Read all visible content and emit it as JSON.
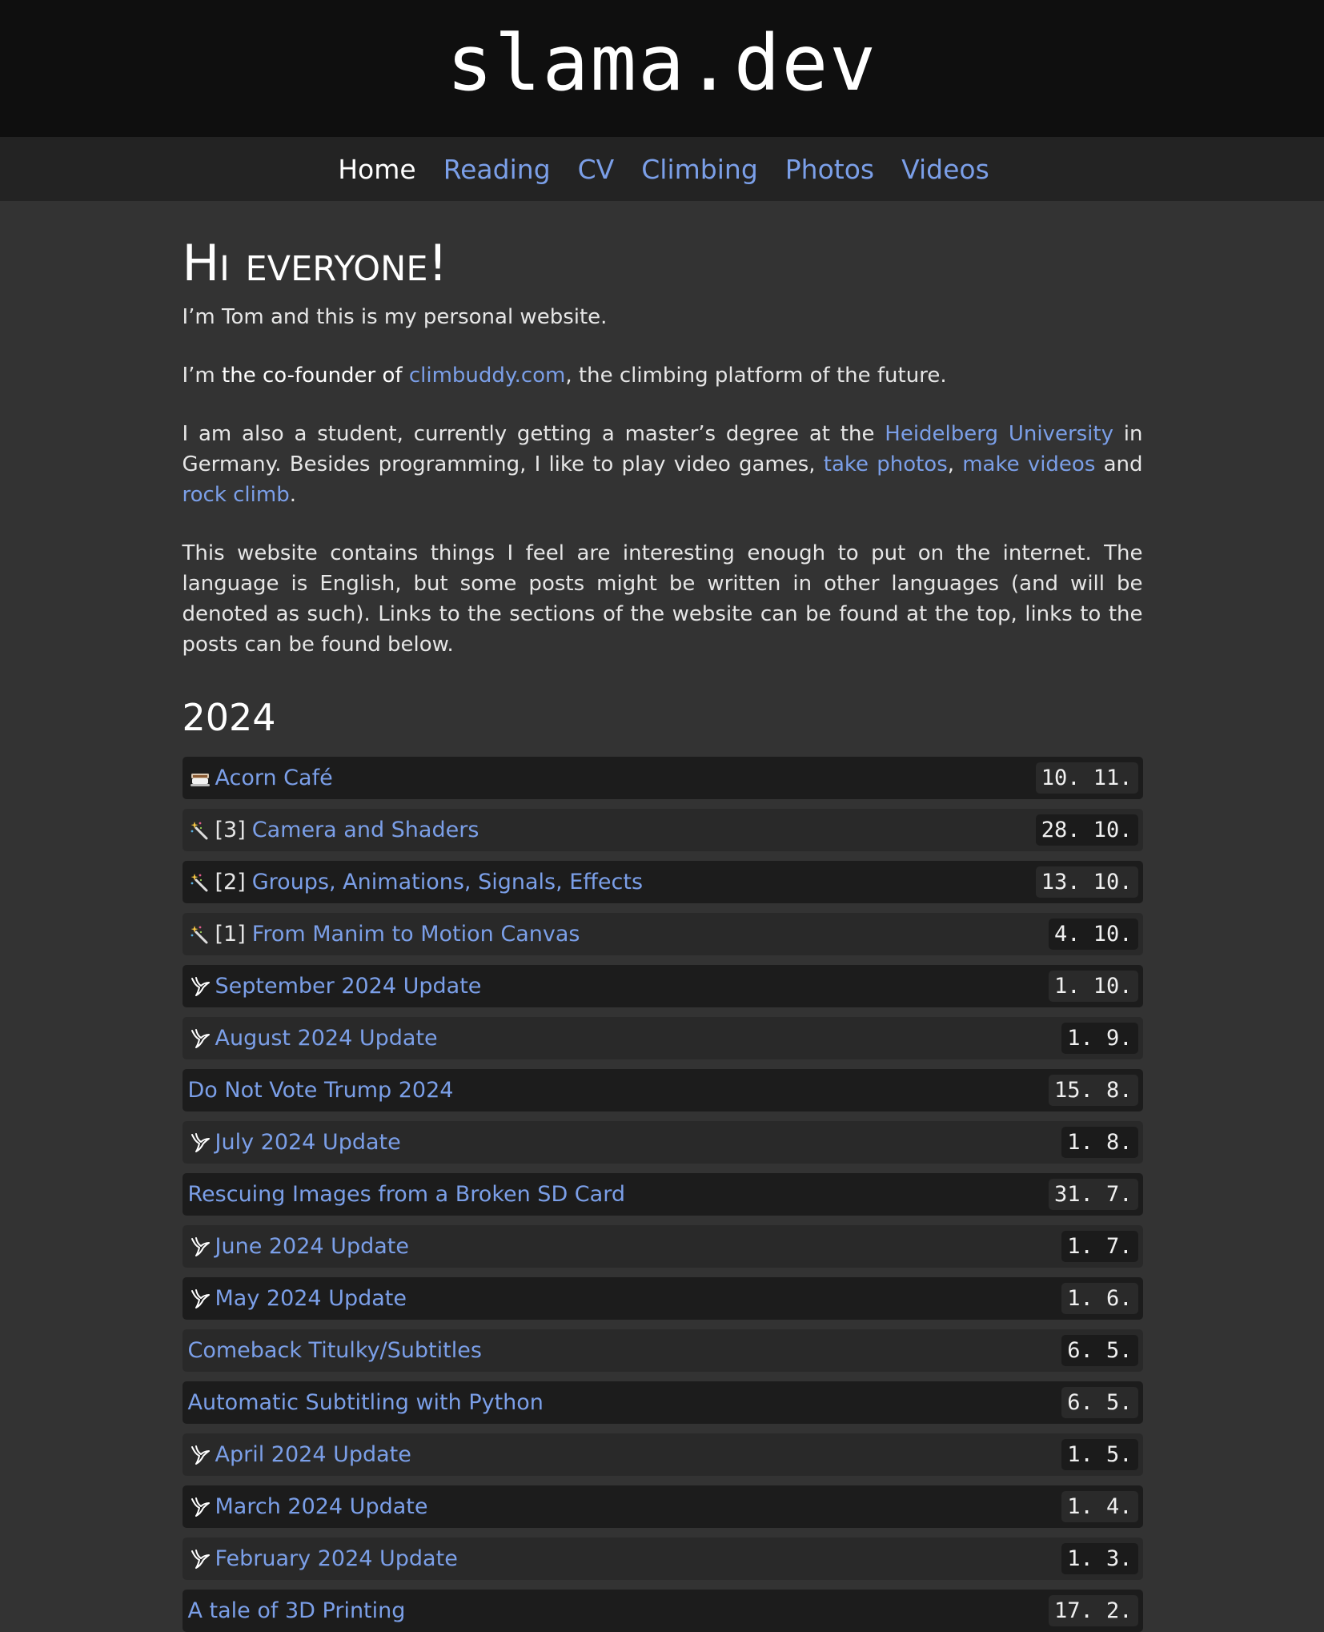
{
  "site": {
    "title": "slama.dev"
  },
  "nav": [
    {
      "label": "Home",
      "name": "nav-home",
      "active": true
    },
    {
      "label": "Reading",
      "name": "nav-reading",
      "active": false
    },
    {
      "label": "CV",
      "name": "nav-cv",
      "active": false
    },
    {
      "label": "Climbing",
      "name": "nav-climbing",
      "active": false
    },
    {
      "label": "Photos",
      "name": "nav-photos",
      "active": false
    },
    {
      "label": "Videos",
      "name": "nav-videos",
      "active": false
    }
  ],
  "intro": {
    "heading": "Hi everyone!",
    "p1": "I’m Tom and this is my personal website.",
    "p2": {
      "before": "I’m ",
      "strong": "the co-founder of",
      "space": " ",
      "link": "climbuddy.com",
      "after": ", the climbing platform of the future."
    },
    "p3": {
      "t1": "I am also a student, currently getting a master’s degree at the ",
      "l1": "Heidelberg University",
      "t2": " in Germany. Besides programming, I like to play video games, ",
      "l2": "take photos",
      "t3": ", ",
      "l3": "make videos",
      "t4": " and ",
      "l4": "rock climb",
      "t5": "."
    },
    "p4": "This website contains things I feel are interesting enough to put on the internet. The language is English, but some posts might be written in other languages (and will be denoted as such). Links to the sections of the website can be found at the top, links to the posts can be found below."
  },
  "posts_section": {
    "year": "2024",
    "posts": [
      {
        "icon": "coffee-icon",
        "prefix": "",
        "title": "Acorn Café",
        "date": "10. 11."
      },
      {
        "icon": "magic-wand-icon",
        "prefix": "[3]",
        "title": "Camera and Shaders",
        "date": "28. 10."
      },
      {
        "icon": "magic-wand-icon",
        "prefix": "[2]",
        "title": "Groups, Animations, Signals, Effects",
        "date": "13. 10."
      },
      {
        "icon": "magic-wand-icon",
        "prefix": "[1]",
        "title": "From Manim to Motion Canvas",
        "date": "4. 10."
      },
      {
        "icon": "bird-icon",
        "prefix": "",
        "title": "September 2024 Update",
        "date": "1. 10."
      },
      {
        "icon": "bird-icon",
        "prefix": "",
        "title": "August 2024 Update",
        "date": "1. 9."
      },
      {
        "icon": "",
        "prefix": "",
        "title": "Do Not Vote Trump 2024",
        "date": "15. 8."
      },
      {
        "icon": "bird-icon",
        "prefix": "",
        "title": "July 2024 Update",
        "date": "1. 8."
      },
      {
        "icon": "",
        "prefix": "",
        "title": "Rescuing Images from a Broken SD Card",
        "date": "31. 7."
      },
      {
        "icon": "bird-icon",
        "prefix": "",
        "title": "June 2024 Update",
        "date": "1. 7."
      },
      {
        "icon": "bird-icon",
        "prefix": "",
        "title": "May 2024 Update",
        "date": "1. 6."
      },
      {
        "icon": "",
        "prefix": "",
        "title": "Comeback Titulky/Subtitles",
        "date": "6. 5."
      },
      {
        "icon": "",
        "prefix": "",
        "title": "Automatic Subtitling with Python",
        "date": "6. 5."
      },
      {
        "icon": "bird-icon",
        "prefix": "",
        "title": "April 2024 Update",
        "date": "1. 5."
      },
      {
        "icon": "bird-icon",
        "prefix": "",
        "title": "March 2024 Update",
        "date": "1. 4."
      },
      {
        "icon": "bird-icon",
        "prefix": "",
        "title": "February 2024 Update",
        "date": "1. 3."
      },
      {
        "icon": "",
        "prefix": "",
        "title": "A tale of 3D Printing",
        "date": "17. 2."
      }
    ]
  },
  "colors": {
    "background": "#333333",
    "header": "#0f0f0f",
    "nav": "#232323",
    "link": "#7b9fe8"
  }
}
